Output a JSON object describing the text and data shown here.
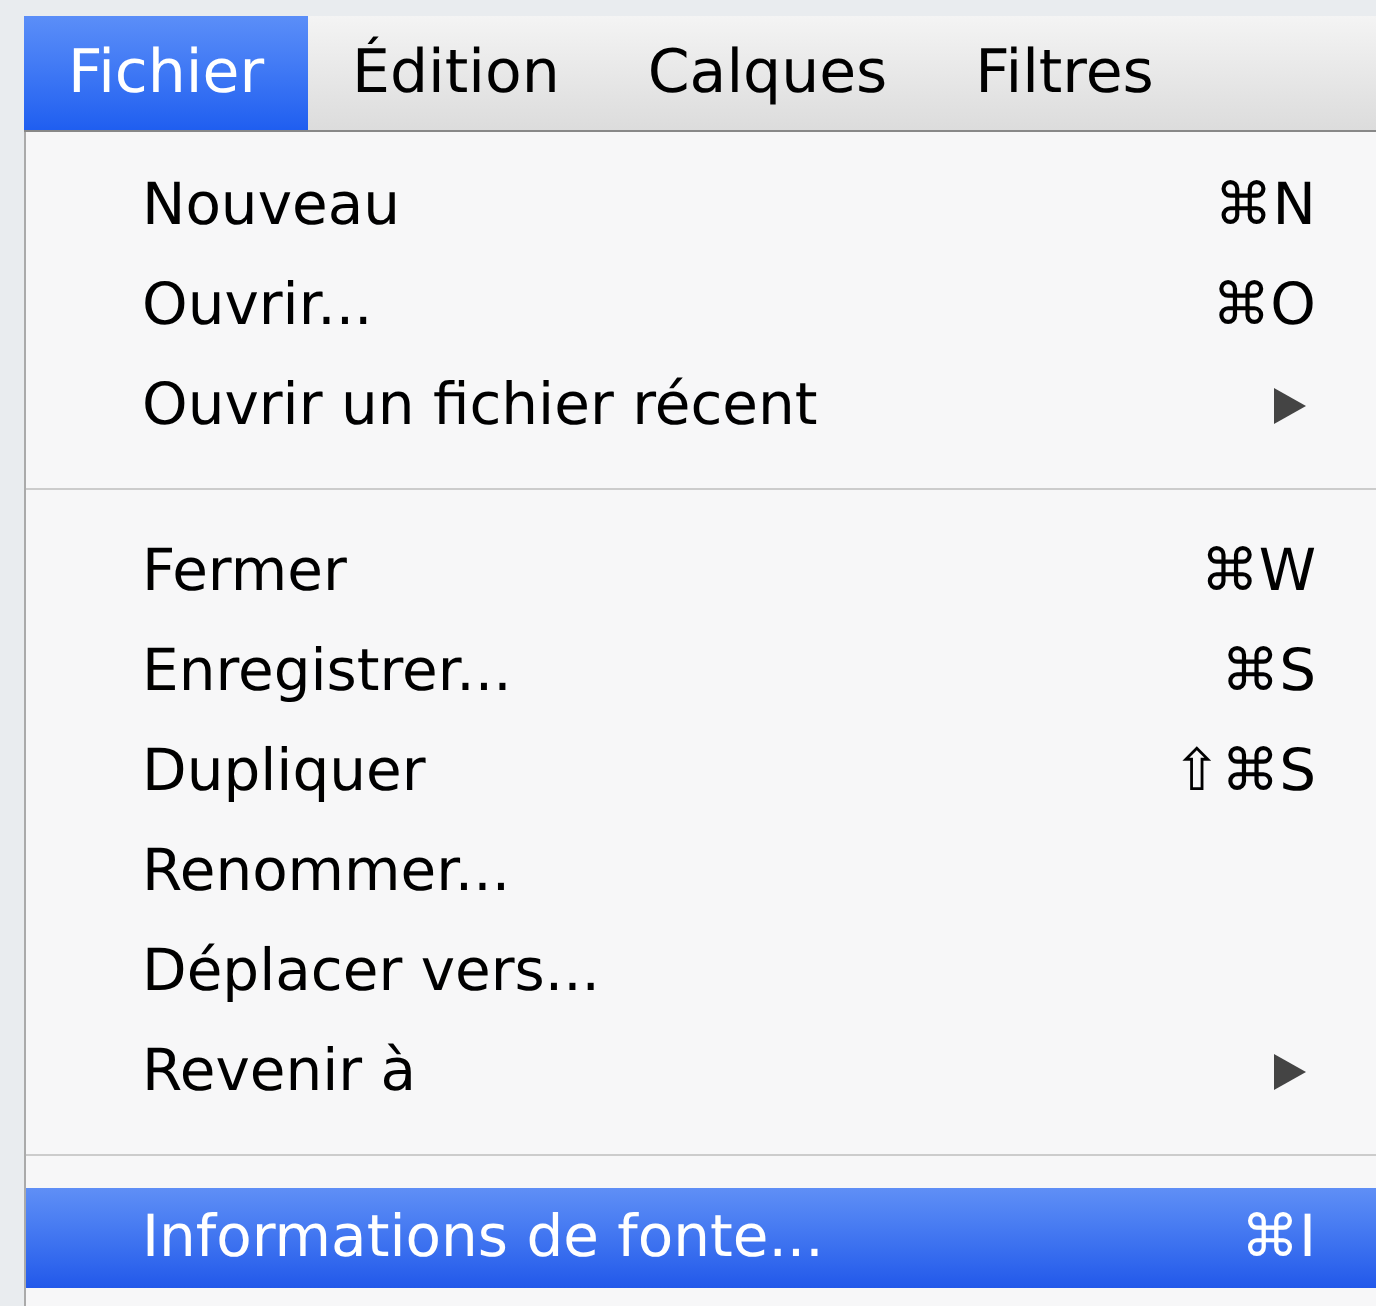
{
  "menubar": [
    {
      "label": "Fichier",
      "selected": true
    },
    {
      "label": "Édition",
      "selected": false
    },
    {
      "label": "Calques",
      "selected": false
    },
    {
      "label": "Filtres",
      "selected": false
    }
  ],
  "menu": {
    "items": [
      {
        "kind": "item",
        "label": "Nouveau",
        "shortcut": "⌘N",
        "submenu": false,
        "selected": false
      },
      {
        "kind": "item",
        "label": "Ouvrir...",
        "shortcut": "⌘O",
        "submenu": false,
        "selected": false
      },
      {
        "kind": "item",
        "label": "Ouvrir un fichier récent",
        "submenu": true,
        "selected": false
      },
      {
        "kind": "separator"
      },
      {
        "kind": "item",
        "label": "Fermer",
        "shortcut": "⌘W",
        "submenu": false,
        "selected": false
      },
      {
        "kind": "item",
        "label": "Enregistrer...",
        "shortcut": "⌘S",
        "submenu": false,
        "selected": false
      },
      {
        "kind": "item",
        "label": "Dupliquer",
        "shortcut": "⇧⌘S",
        "submenu": false,
        "selected": false
      },
      {
        "kind": "item",
        "label": "Renommer...",
        "submenu": false,
        "selected": false
      },
      {
        "kind": "item",
        "label": "Déplacer vers...",
        "submenu": false,
        "selected": false
      },
      {
        "kind": "item",
        "label": "Revenir à",
        "submenu": true,
        "selected": false
      },
      {
        "kind": "separator"
      },
      {
        "kind": "item",
        "label": "Informations de fonte...",
        "shortcut": "⌘I",
        "submenu": false,
        "selected": true
      }
    ]
  }
}
